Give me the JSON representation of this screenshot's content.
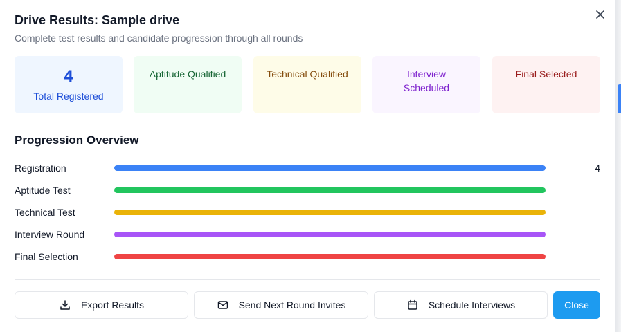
{
  "dialog": {
    "title": "Drive Results: Sample drive",
    "subtitle": "Complete test results and candidate progression through all rounds"
  },
  "stats": [
    {
      "value": "4",
      "label": "Total Registered",
      "bg": "#eff6ff",
      "color": "#1d4ed8"
    },
    {
      "value": "",
      "label": "Aptitude Qualified",
      "bg": "#f0fdf4",
      "color": "#166534"
    },
    {
      "value": "",
      "label": "Technical Qualified",
      "bg": "#fefce8",
      "color": "#854d0e"
    },
    {
      "value": "",
      "label_line1": "Interview",
      "label_line2": "Scheduled",
      "bg": "#faf5ff",
      "color": "#7e22ce"
    },
    {
      "value": "",
      "label": "Final Selected",
      "bg": "#fef2f2",
      "color": "#991b1b"
    }
  ],
  "progression": {
    "title": "Progression Overview",
    "rows": [
      {
        "label": "Registration",
        "count": "4",
        "color": "#3b82f6"
      },
      {
        "label": "Aptitude Test",
        "count": "",
        "color": "#22c55e"
      },
      {
        "label": "Technical Test",
        "count": "",
        "color": "#eab308"
      },
      {
        "label": "Interview Round",
        "count": "",
        "color": "#a855f7"
      },
      {
        "label": "Final Selection",
        "count": "",
        "color": "#ef4444"
      }
    ]
  },
  "actions": {
    "export": {
      "label": "Export Results",
      "icon": "download-icon"
    },
    "invites": {
      "label": "Send Next Round Invites",
      "icon": "mail-icon"
    },
    "schedule": {
      "label": "Schedule Interviews",
      "icon": "calendar-icon"
    },
    "close": {
      "label": "Close"
    }
  },
  "colors": {
    "primary": "#1d9bf0"
  }
}
